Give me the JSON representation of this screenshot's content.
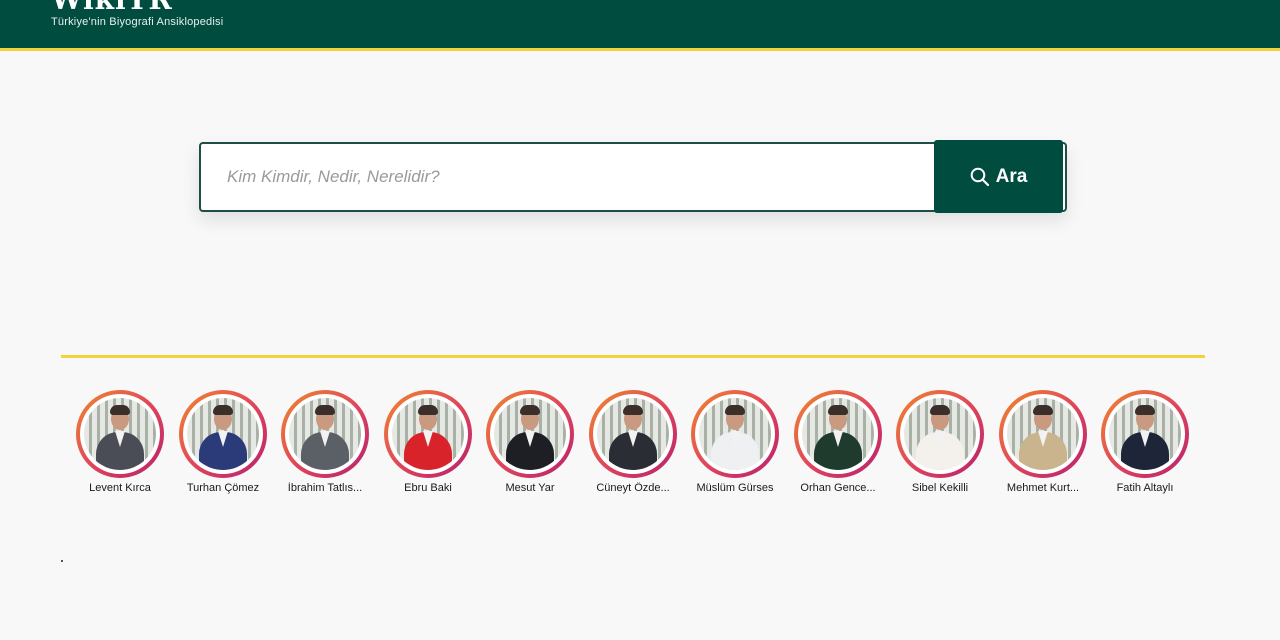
{
  "header": {
    "logo": "WikiTR",
    "tagline": "Türkiye'nin Biyografi Ansiklopedisi"
  },
  "search": {
    "placeholder": "Kim Kimdir, Nedir, Nerelidir?",
    "button_label": "Ara",
    "button_icon": "search-icon"
  },
  "colors": {
    "header_bg": "#004d40",
    "accent_yellow": "#f2d43a",
    "story_ring": [
      "#f08a2c",
      "#e0475a",
      "#b8206e"
    ]
  },
  "stories": [
    {
      "name": "Levent Kırca",
      "outfit": "#4a4d55"
    },
    {
      "name": "Turhan Çömez",
      "outfit": "#2b3a78"
    },
    {
      "name": "İbrahim Tatlıs...",
      "outfit": "#5b5f66"
    },
    {
      "name": "Ebru Baki",
      "outfit": "#d8232a"
    },
    {
      "name": "Mesut Yar",
      "outfit": "#1d1f24"
    },
    {
      "name": "Cüneyt Özde...",
      "outfit": "#2a2d33"
    },
    {
      "name": "Müslüm Gürses",
      "outfit": "#eef0f2"
    },
    {
      "name": "Orhan Gence...",
      "outfit": "#1e3b2e"
    },
    {
      "name": "Sibel Kekilli",
      "outfit": "#f4f1ec"
    },
    {
      "name": "Mehmet Kurt...",
      "outfit": "#c9b48e"
    },
    {
      "name": "Fatih Altaylı",
      "outfit": "#1f2538"
    }
  ]
}
